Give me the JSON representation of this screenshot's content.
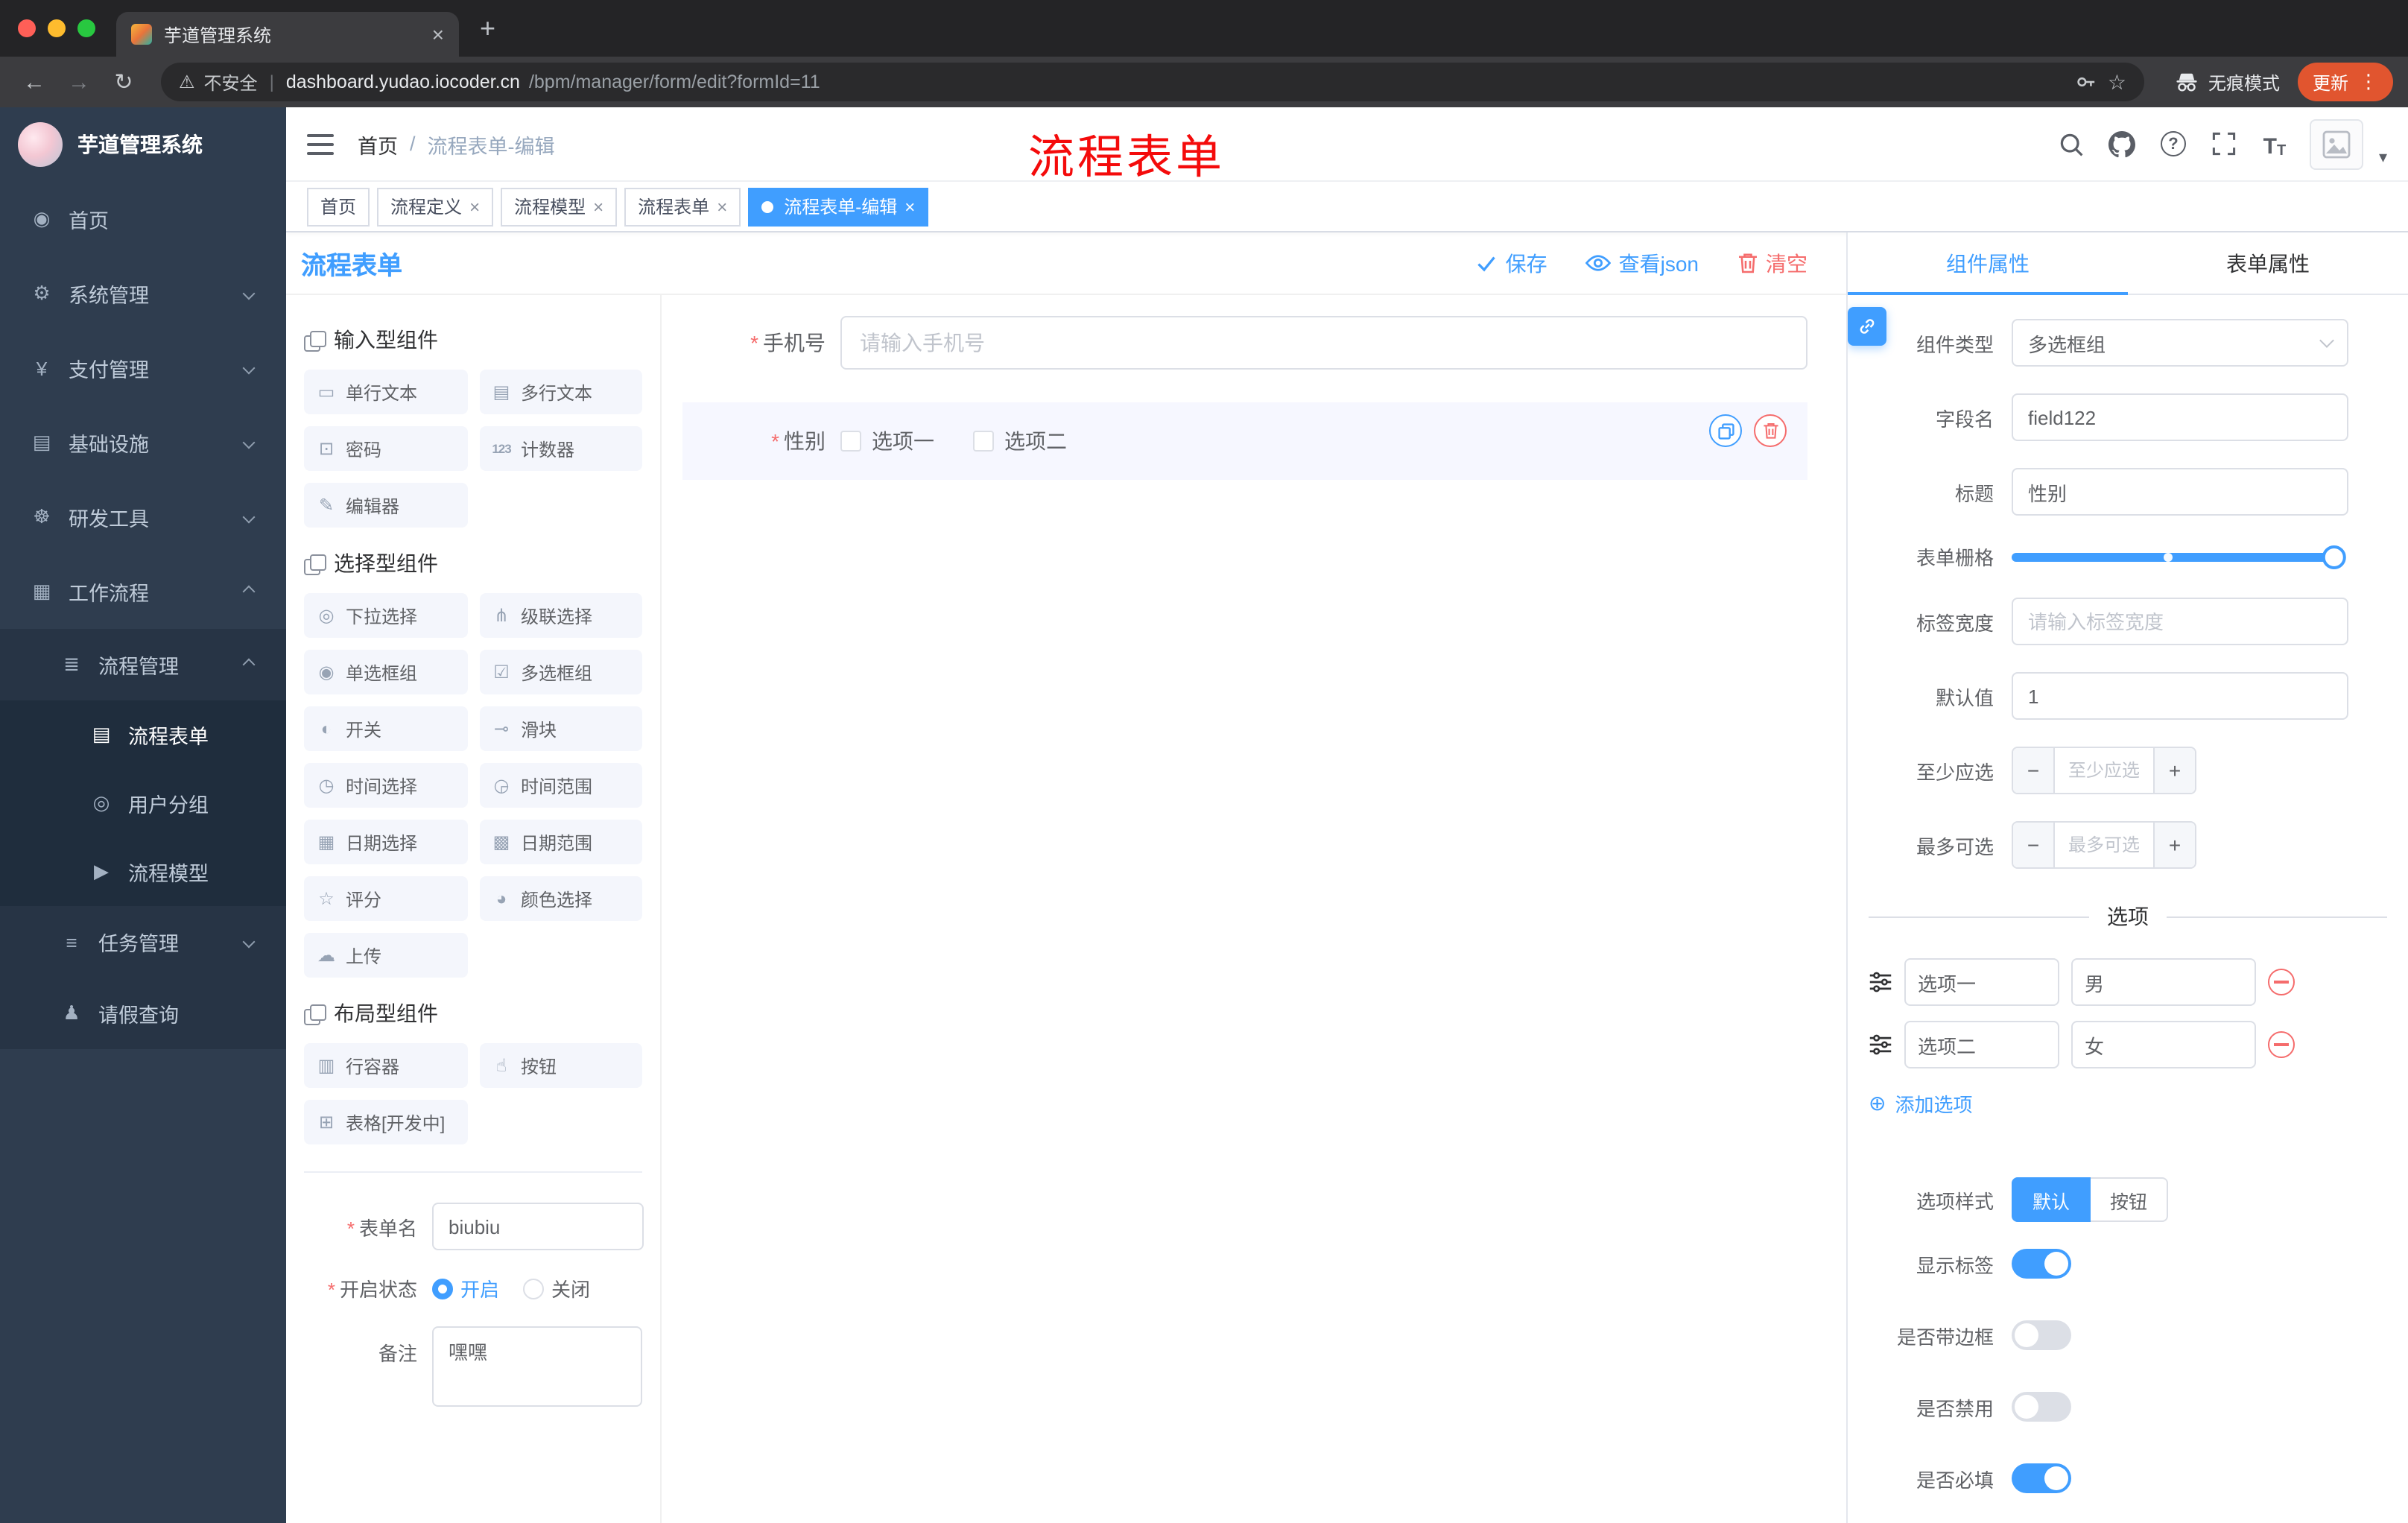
{
  "colors": {
    "primary": "#409eff",
    "danger": "#f56c6c",
    "annotation": "#f40b0b",
    "tag_active": "#409eff"
  },
  "glyphs": {
    "close": "×",
    "new_tab": "+",
    "back": "←",
    "forward": "→",
    "reload": "↻",
    "warning": "⚠",
    "divider": "|",
    "star": "☆",
    "menu_dots": "⋮",
    "caret_down": "▾",
    "breadcrumb_sep": "/",
    "question": "?",
    "add_circle": "⊕",
    "required": "*",
    "minus": "−",
    "plus": "+",
    "t_big": "T",
    "t_small": "T"
  },
  "browser": {
    "tab_title": "芋道管理系统",
    "security_label": "不安全",
    "url_host": "dashboard.yudao.iocoder.cn",
    "url_path": "/bpm/manager/form/edit?formId=11",
    "incognito_label": "无痕模式",
    "update_label": "更新"
  },
  "sidebar": {
    "brand": "芋道管理系统",
    "items": [
      {
        "label": "首页",
        "glyph": "◉"
      },
      {
        "label": "系统管理",
        "glyph": "⚙"
      },
      {
        "label": "支付管理",
        "glyph": "¥"
      },
      {
        "label": "基础设施",
        "glyph": "▤"
      },
      {
        "label": "研发工具",
        "glyph": "☸"
      },
      {
        "label": "工作流程",
        "glyph": "▦"
      },
      {
        "label": "流程管理",
        "glyph": "≣"
      },
      {
        "label": "流程表单",
        "glyph": "▤"
      },
      {
        "label": "用户分组",
        "glyph": "◎"
      },
      {
        "label": "流程模型",
        "glyph": "▶"
      },
      {
        "label": "任务管理",
        "glyph": "≡"
      },
      {
        "label": "请假查询",
        "glyph": "♟"
      }
    ]
  },
  "navbar": {
    "breadcrumb": {
      "home": "首页",
      "current": "流程表单-编辑"
    },
    "annotation": "流程表单"
  },
  "tags": [
    {
      "label": "首页"
    },
    {
      "label": "流程定义"
    },
    {
      "label": "流程模型"
    },
    {
      "label": "流程表单"
    },
    {
      "label": "流程表单-编辑"
    }
  ],
  "designer": {
    "title": "流程表单",
    "save_label": "保存",
    "view_json_label": "查看json",
    "clear_label": "清空"
  },
  "palette": {
    "sections": [
      {
        "title": "输入型组件",
        "items": [
          {
            "label": "单行文本",
            "glyph": "▭"
          },
          {
            "label": "多行文本",
            "glyph": "▤"
          },
          {
            "label": "密码",
            "glyph": "⊡"
          },
          {
            "label": "计数器",
            "glyph": "123"
          },
          {
            "label": "编辑器",
            "glyph": "✎"
          }
        ]
      },
      {
        "title": "选择型组件",
        "items": [
          {
            "label": "下拉选择",
            "glyph": "◎"
          },
          {
            "label": "级联选择",
            "glyph": "⋔"
          },
          {
            "label": "单选框组",
            "glyph": "◉"
          },
          {
            "label": "多选框组",
            "glyph": "☑"
          },
          {
            "label": "开关",
            "glyph": "◐"
          },
          {
            "label": "滑块",
            "glyph": "⊸"
          },
          {
            "label": "时间选择",
            "glyph": "◷"
          },
          {
            "label": "时间范围",
            "glyph": "◶"
          },
          {
            "label": "日期选择",
            "glyph": "▦"
          },
          {
            "label": "日期范围",
            "glyph": "▩"
          },
          {
            "label": "评分",
            "glyph": "☆"
          },
          {
            "label": "颜色选择",
            "glyph": "◕"
          },
          {
            "label": "上传",
            "glyph": "☁"
          }
        ]
      },
      {
        "title": "布局型组件",
        "items": [
          {
            "label": "行容器",
            "glyph": "▥"
          },
          {
            "label": "按钮",
            "glyph": "☝"
          },
          {
            "label": "表格[开发中]",
            "glyph": "⊞"
          }
        ]
      }
    ],
    "form": {
      "name_label": "表单名",
      "name_value": "biubiu",
      "status_label": "开启状态",
      "status_on": "开启",
      "status_off": "关闭",
      "remark_label": "备注",
      "remark_value": "嘿嘿"
    }
  },
  "canvas": {
    "phone": {
      "label": "手机号",
      "placeholder": "请输入手机号"
    },
    "gender": {
      "label": "性别",
      "options": [
        "选项一",
        "选项二"
      ]
    }
  },
  "props": {
    "tabs": {
      "component": "组件属性",
      "form": "表单属性"
    },
    "component_type_label": "组件类型",
    "component_type_value": "多选框组",
    "field_name_label": "字段名",
    "field_name_value": "field122",
    "title_label": "标题",
    "title_value": "性别",
    "grid_label": "表单栅格",
    "label_width_label": "标签宽度",
    "label_width_placeholder": "请输入标签宽度",
    "default_label": "默认值",
    "default_value": "1",
    "min_label": "至少应选",
    "min_placeholder": "至少应选",
    "max_label": "最多可选",
    "max_placeholder": "最多可选",
    "options": {
      "divider": "选项",
      "rows": [
        {
          "name": "选项一",
          "value": "男"
        },
        {
          "name": "选项二",
          "value": "女"
        }
      ],
      "add": "添加选项"
    },
    "style": {
      "label": "选项样式",
      "segments": [
        "默认",
        "按钮"
      ]
    },
    "switches": [
      {
        "label": "显示标签"
      },
      {
        "label": "是否带边框"
      },
      {
        "label": "是否禁用"
      },
      {
        "label": "是否必填"
      }
    ]
  }
}
